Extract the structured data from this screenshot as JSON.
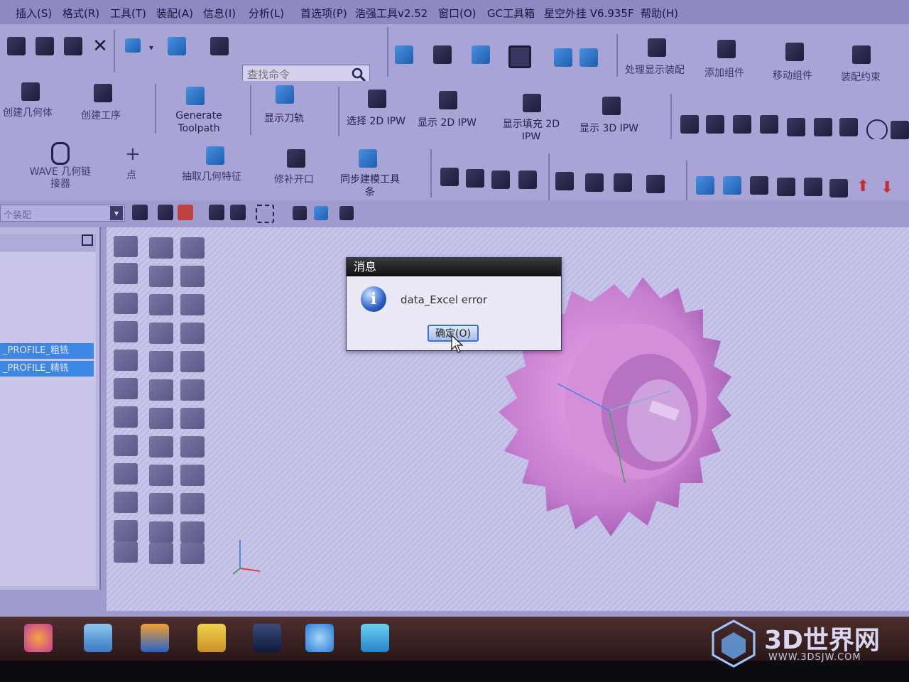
{
  "menubar": {
    "items": [
      "插入(S)",
      "格式(R)",
      "工具(T)",
      "装配(A)",
      "信息(I)",
      "分析(L)",
      "首选项(P)",
      "浩强工具v2.52",
      "窗口(O)",
      "GC工具箱",
      "星空外挂 V6.935F",
      "帮助(H)"
    ]
  },
  "toolbar": {
    "search_placeholder": "查找命令",
    "assembly": [
      "处理显示装配",
      "添加组件",
      "移动组件",
      "装配约束"
    ],
    "row2": {
      "create_geometry": "创建几何体",
      "create_operation": "创建工序",
      "generate_toolpath": "Generate Toolpath",
      "show_toolpath": "显示刀轨",
      "select_2d_ipw": "选择 2D IPW",
      "show_2d_ipw": "显示 2D IPW",
      "show_fill_2d_ipw": "显示填充 2D IPW",
      "show_3d_ipw": "显示 3D IPW"
    },
    "row3": {
      "wave_linker": "WAVE 几何链接器",
      "point": "点",
      "extract_feature": "抽取几何特征",
      "patch_opening": "修补开口",
      "sync_toolbar": "同步建模工具条"
    },
    "row4_filter": "个装配"
  },
  "navigator": {
    "rows": [
      "_PROFILE_粗铣",
      "_PROFILE_精铣"
    ]
  },
  "dialog": {
    "title": "消息",
    "message": "data_Excel error",
    "ok_label": "确定(O)"
  },
  "watermark": {
    "brand": "3D世界网",
    "url": "WWW.3DSJW.COM"
  }
}
